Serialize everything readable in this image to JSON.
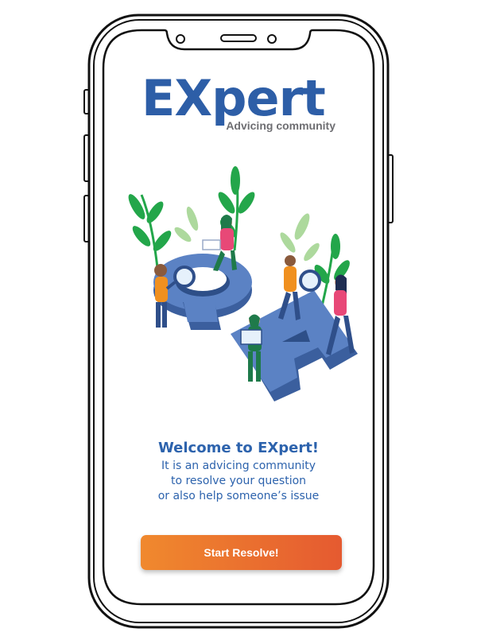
{
  "app": {
    "logo_text": "EXpert",
    "logo_subtitle": "Advicing community"
  },
  "welcome": {
    "title": "Welcome to EXpert!",
    "lines": [
      "It is an advicing community",
      "to resolve your question",
      "or also help someone’s issue"
    ]
  },
  "actions": {
    "start_label": "Start Resolve!"
  },
  "colors": {
    "brand_blue": "#2d5ea7",
    "accent_blue": "#3aa0d8",
    "button_start": "#f0892e",
    "button_end": "#e55a30"
  },
  "illustration": {
    "icon": "qa-people-illustration",
    "letters": [
      "Q",
      "A"
    ]
  }
}
